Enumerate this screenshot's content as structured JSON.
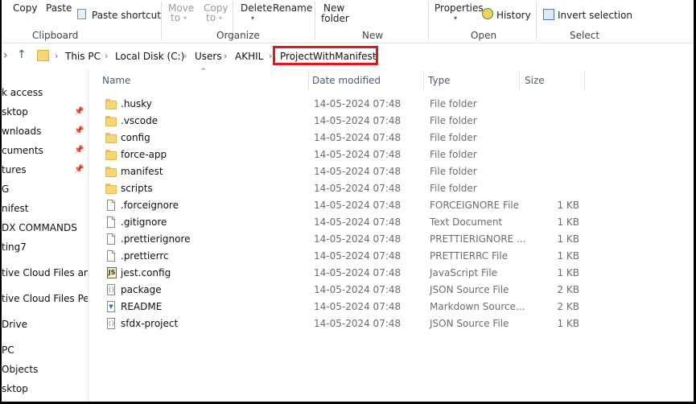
{
  "ribbon": {
    "clipboard": {
      "copy": "Copy",
      "paste": "Paste",
      "paste_shortcut": "Paste shortcut",
      "group": "Clipboard"
    },
    "organize": {
      "move_to": "Move",
      "move_to_2": "to",
      "copy_to": "Copy",
      "copy_to_2": "to",
      "delete": "Delete",
      "rename": "Rename",
      "group": "Organize"
    },
    "new": {
      "new_folder": "New",
      "new_folder_2": "folder",
      "group": "New"
    },
    "open": {
      "properties": "Properties",
      "history": "History",
      "group": "Open"
    },
    "select": {
      "invert_selection": "Invert selection",
      "group": "Select"
    }
  },
  "address": {
    "crumbs": [
      "This PC",
      "Local Disk (C:)",
      "Users",
      "AKHIL",
      "ProjectWithManifest"
    ]
  },
  "nav": {
    "items": [
      {
        "label": "k access",
        "pinned": false
      },
      {
        "label": "sktop",
        "pinned": true
      },
      {
        "label": "wnloads",
        "pinned": true
      },
      {
        "label": "cuments",
        "pinned": true
      },
      {
        "label": "tures",
        "pinned": true
      },
      {
        "label": "G",
        "pinned": false
      },
      {
        "label": "nifest",
        "pinned": false
      },
      {
        "label": "DX COMMANDS",
        "pinned": false
      },
      {
        "label": "ting7",
        "pinned": false
      },
      {
        "label": "tive Cloud Files  am",
        "pinned": false
      },
      {
        "label": "tive Cloud Files Pers",
        "pinned": false
      },
      {
        "label": "Drive",
        "pinned": false
      },
      {
        "label": "PC",
        "pinned": false
      },
      {
        "label": "Objects",
        "pinned": false
      },
      {
        "label": "sktop",
        "pinned": false
      }
    ]
  },
  "columns": {
    "name": "Name",
    "date": "Date modified",
    "type": "Type",
    "size": "Size"
  },
  "files": [
    {
      "name": ".husky",
      "date": "14-05-2024 07:48",
      "type": "File folder",
      "size": "",
      "icon": "folder-icon"
    },
    {
      "name": ".vscode",
      "date": "14-05-2024 07:48",
      "type": "File folder",
      "size": "",
      "icon": "folder-icon"
    },
    {
      "name": "config",
      "date": "14-05-2024 07:48",
      "type": "File folder",
      "size": "",
      "icon": "folder-icon"
    },
    {
      "name": "force-app",
      "date": "14-05-2024 07:48",
      "type": "File folder",
      "size": "",
      "icon": "folder-icon"
    },
    {
      "name": "manifest",
      "date": "14-05-2024 07:48",
      "type": "File folder",
      "size": "",
      "icon": "folder-icon"
    },
    {
      "name": "scripts",
      "date": "14-05-2024 07:48",
      "type": "File folder",
      "size": "",
      "icon": "folder-icon"
    },
    {
      "name": ".forceignore",
      "date": "14-05-2024 07:48",
      "type": "FORCEIGNORE File",
      "size": "1 KB",
      "icon": "file-icon"
    },
    {
      "name": ".gitignore",
      "date": "14-05-2024 07:48",
      "type": "Text Document",
      "size": "1 KB",
      "icon": "file-icon"
    },
    {
      "name": ".prettierignore",
      "date": "14-05-2024 07:48",
      "type": "PRETTIERIGNORE ...",
      "size": "1 KB",
      "icon": "file-icon"
    },
    {
      "name": ".prettierrc",
      "date": "14-05-2024 07:48",
      "type": "PRETTIERRC File",
      "size": "1 KB",
      "icon": "file-icon"
    },
    {
      "name": "jest.config",
      "date": "14-05-2024 07:48",
      "type": "JavaScript File",
      "size": "1 KB",
      "icon": "js-file-icon"
    },
    {
      "name": "package",
      "date": "14-05-2024 07:48",
      "type": "JSON Source File",
      "size": "2 KB",
      "icon": "json-file-icon"
    },
    {
      "name": "README",
      "date": "14-05-2024 07:48",
      "type": "Markdown Source...",
      "size": "2 KB",
      "icon": "markdown-file-icon"
    },
    {
      "name": "sfdx-project",
      "date": "14-05-2024 07:48",
      "type": "JSON Source File",
      "size": "1 KB",
      "icon": "json-file-icon"
    }
  ],
  "colors": {
    "highlight": "#e0191f",
    "folder": "#f7d673",
    "header_text": "#4a5d7a"
  }
}
